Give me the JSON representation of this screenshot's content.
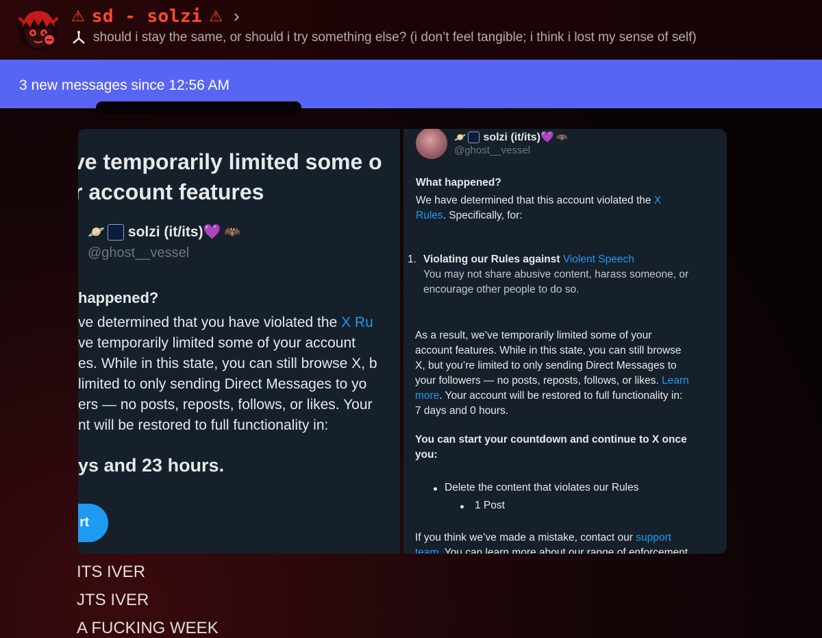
{
  "header": {
    "channel_name": "sd - solzi",
    "topic": "should i stay the same, or should i try something else? (i don’t feel tangible; i think i lost my sense of self)"
  },
  "new_messages_bar": {
    "text": "3 new messages since 12:56 AM"
  },
  "left_screenshot": {
    "title_line1": "ve temporarily limited some o",
    "title_line2": "r account features",
    "display_name": "solzi (it/its)💜",
    "handle": "@ghost__vessel",
    "section_title": "happened?",
    "body_line1_a": "ve determined that you have violated the ",
    "body_line1_link": "X Ru",
    "body_line2": "ve temporarily limited some of your account",
    "body_line3": "es. While in this state, you can still browse X, b",
    "body_line4": " limited to only sending Direct Messages to yo",
    "body_line5": "ers — no posts, reposts, follows, or likes. Your",
    "body_line6": "nt will be restored to full functionality in:",
    "countdown": "ys and 23 hours.",
    "button_label": "rt"
  },
  "right_screenshot": {
    "display_name": "solzi (it/its)💜",
    "handle": "@ghost__vessel",
    "what_happened": "What happened?",
    "determined_a": "We have determined that this account violated the ",
    "determined_link_a": "X",
    "determined_link_b": "Rules",
    "determined_b": ". Specifically, for:",
    "violation_number": "1.",
    "violation_title": "Violating our Rules against ",
    "violation_link": "Violent Speech",
    "violation_desc_1": "You may not share abusive content, harass someone, or",
    "violation_desc_2": "encourage other people to do so.",
    "result_1": "As a result, we’ve temporarily limited some of your",
    "result_2": "account features. While in this state, you can still browse",
    "result_3": "X, but you’re limited to only sending Direct Messages to",
    "result_4a": "your followers — no posts, reposts, follows, or likes. ",
    "result_4_link": "Learn",
    "result_5_link": "more",
    "result_5b": ". Your account will be restored to full functionality in:",
    "result_6": "7 days and 0 hours.",
    "countdown_heading_1": "You can start your countdown and continue to X once",
    "countdown_heading_2": "you:",
    "bullet_1": "Delete the content that violates our Rules",
    "bullet_2": "1 Post",
    "mistake_a": "If you think we’ve made a mistake, contact our ",
    "mistake_link": "support",
    "mistake_link_2": "team",
    "mistake_b": ". You can learn more about our range of enforcement"
  },
  "messages": [
    "ITS IVER",
    "JTS IVER",
    "A FUCKING WEEK"
  ],
  "colors": {
    "accent_bar": "#5865f2",
    "channel_name": "#ff4a2e",
    "x_link": "#1d9bf0",
    "x_background": "#15202b",
    "status_dnd": "#f23f43"
  },
  "icons": [
    "avatar",
    "dnd-status-icon",
    "ornament-icon",
    "chevron-right-icon",
    "planet-emoji-icon",
    "galaxy-emoji-icon",
    "purple-heart-emoji",
    "bat-emoji-icon"
  ]
}
